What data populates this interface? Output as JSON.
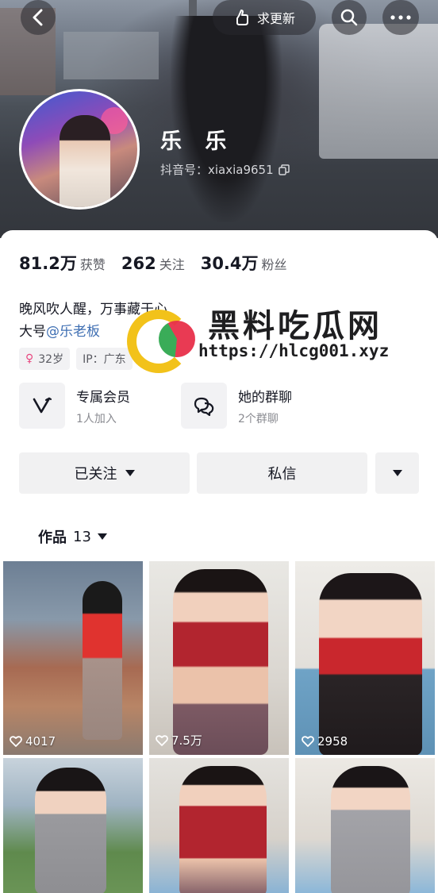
{
  "header": {
    "ask_update_label": "求更新"
  },
  "profile": {
    "nickname": "乐 乐",
    "douyin_id": "抖音号：xiaxia9651"
  },
  "stats": [
    {
      "value": "81.2万",
      "label": "获赞"
    },
    {
      "value": "262",
      "label": "关注"
    },
    {
      "value": "30.4万",
      "label": "粉丝"
    }
  ],
  "bio": {
    "line1": "晚风吹人醒，万事藏于心",
    "line2_prefix": "大号",
    "line2_mention": "@乐老板"
  },
  "tags": {
    "age": "32岁",
    "ip": "IP：广东"
  },
  "entries": {
    "member_title": "专属会员",
    "member_sub": "1人加入",
    "group_title": "她的群聊",
    "group_sub": "2个群聊"
  },
  "actions": {
    "followed": "已关注",
    "message": "私信"
  },
  "works_tab": {
    "label": "作品",
    "count": "13"
  },
  "watermark": {
    "title": "黑料吃瓜网",
    "url": "https://hlcg001.xyz"
  },
  "videos": [
    {
      "likes": "4017"
    },
    {
      "likes": "7.5万"
    },
    {
      "likes": "2958"
    },
    {
      "likes": ""
    },
    {
      "likes": ""
    },
    {
      "likes": ""
    }
  ],
  "colors": {
    "mention": "#3f6fb3",
    "female_icon": "#e8467f",
    "button_bg": "#f1f1f2"
  }
}
